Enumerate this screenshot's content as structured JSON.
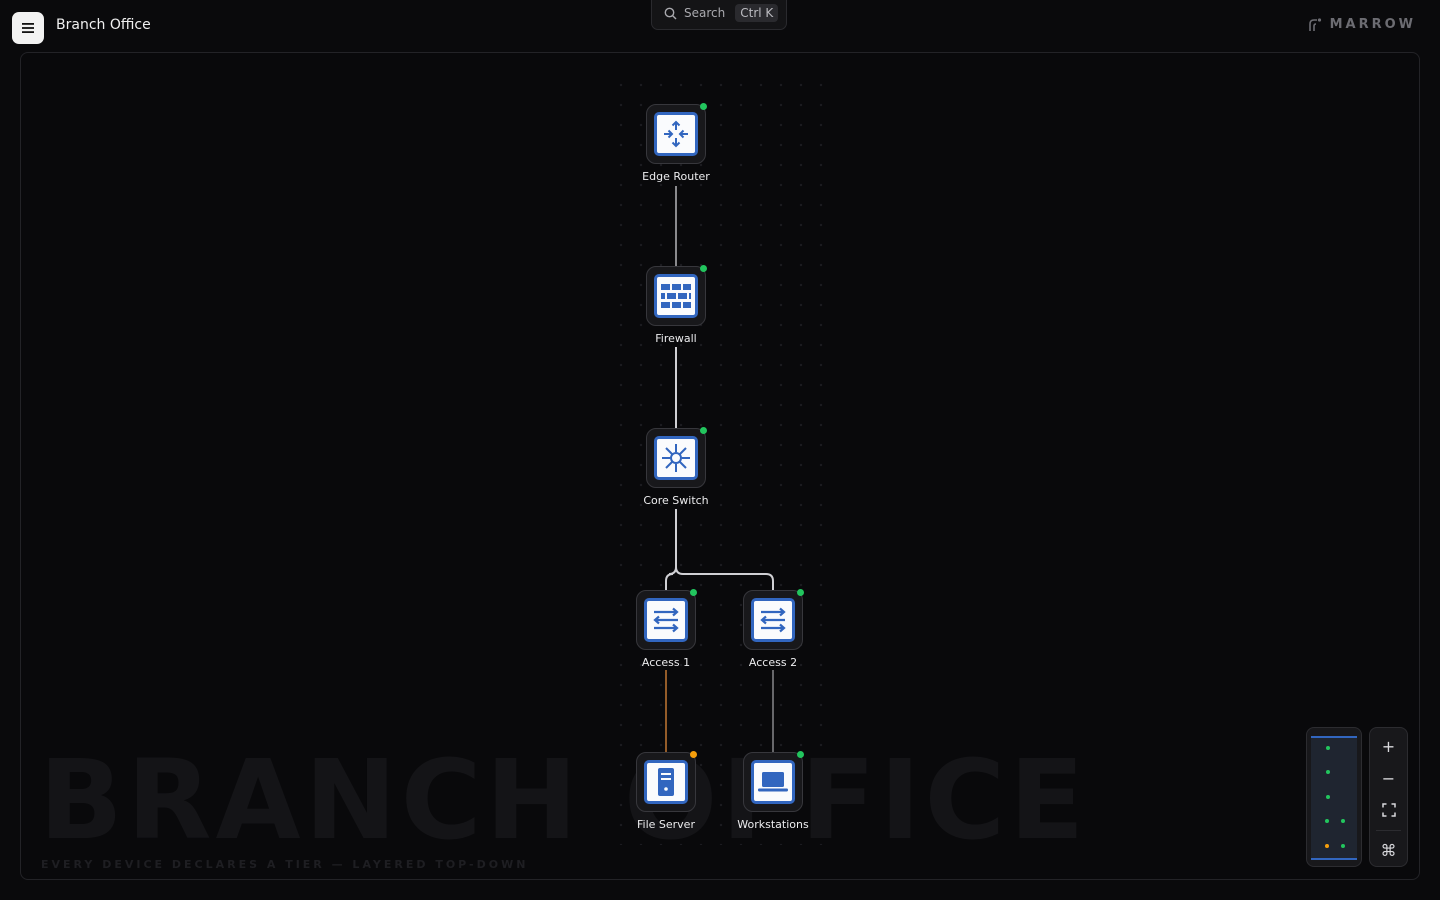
{
  "header": {
    "title": "Branch Office",
    "search": {
      "label": "Search",
      "shortcut": "Ctrl K"
    },
    "brand": "MARROW"
  },
  "canvas": {
    "watermark": "BRANCH OFFICE",
    "subtitle": "EVERY DEVICE DECLARES A TIER — LAYERED TOP-DOWN"
  },
  "nodes": [
    {
      "id": "edge-router",
      "label": "Edge Router",
      "icon": "router-icon",
      "status": "online",
      "status_color": "#22c55e"
    },
    {
      "id": "firewall",
      "label": "Firewall",
      "icon": "firewall-icon",
      "status": "online",
      "status_color": "#22c55e"
    },
    {
      "id": "core-switch",
      "label": "Core Switch",
      "icon": "core-switch-icon",
      "status": "online",
      "status_color": "#22c55e"
    },
    {
      "id": "access-1",
      "label": "Access 1",
      "icon": "switch-icon",
      "status": "online",
      "status_color": "#22c55e"
    },
    {
      "id": "access-2",
      "label": "Access 2",
      "icon": "switch-icon",
      "status": "online",
      "status_color": "#22c55e"
    },
    {
      "id": "file-server",
      "label": "File Server",
      "icon": "server-icon",
      "status": "warning",
      "status_color": "#f59e0b"
    },
    {
      "id": "workstations",
      "label": "Workstations",
      "icon": "laptop-icon",
      "status": "online",
      "status_color": "#22c55e"
    }
  ],
  "links": [
    {
      "from": "edge-router",
      "to": "firewall",
      "color": "#b5b5b9"
    },
    {
      "from": "firewall",
      "to": "core-switch",
      "color": "#d0d0d4"
    },
    {
      "from": "core-switch",
      "to": "access-1",
      "color": "#d0d0d4"
    },
    {
      "from": "core-switch",
      "to": "access-2",
      "color": "#d0d0d4"
    },
    {
      "from": "access-1",
      "to": "file-server",
      "color": "#e0893a"
    },
    {
      "from": "access-2",
      "to": "workstations",
      "color": "#9a9a9e"
    }
  ],
  "colors": {
    "accent": "#3266bf",
    "online": "#22c55e",
    "warning": "#f59e0b",
    "background": "#0a0a0c"
  },
  "controls": {
    "zoom_in": "+",
    "zoom_out": "−",
    "fit": "fit-view-icon",
    "shortcuts": "⌘"
  }
}
